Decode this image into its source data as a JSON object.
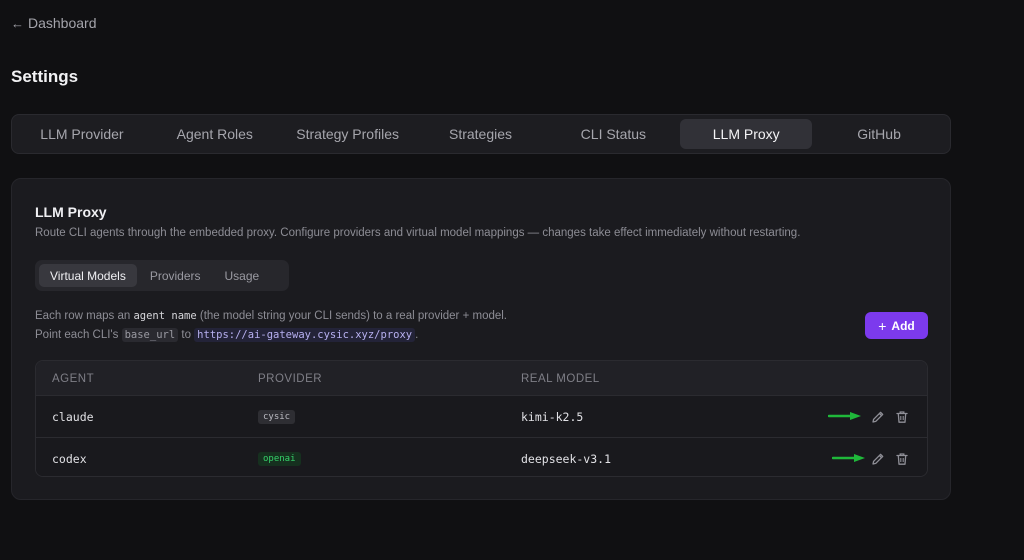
{
  "nav": {
    "back_label": "Dashboard"
  },
  "page": {
    "title": "Settings"
  },
  "tabs": [
    {
      "label": "LLM Provider",
      "active": false
    },
    {
      "label": "Agent Roles",
      "active": false
    },
    {
      "label": "Strategy Profiles",
      "active": false
    },
    {
      "label": "Strategies",
      "active": false
    },
    {
      "label": "CLI Status",
      "active": false
    },
    {
      "label": "LLM Proxy",
      "active": true
    },
    {
      "label": "GitHub",
      "active": false
    }
  ],
  "section": {
    "title": "LLM Proxy",
    "description": "Route CLI agents through the embedded proxy. Configure providers and virtual model mappings — changes take effect immediately without restarting."
  },
  "subtabs": [
    {
      "label": "Virtual Models",
      "active": true
    },
    {
      "label": "Providers",
      "active": false
    },
    {
      "label": "Usage",
      "active": false
    }
  ],
  "help": {
    "part1": "Each row maps an",
    "code_agent_name": "agent name",
    "part2": "(the model string your CLI sends) to a real provider + model. Point each CLI's",
    "code_base_url": "base_url",
    "part3": "to",
    "code_url": "https://ai-gateway.cysic.xyz/proxy",
    "part4": "."
  },
  "add_button": {
    "label": "Add"
  },
  "table": {
    "headers": {
      "agent": "AGENT",
      "provider": "PROVIDER",
      "real_model": "REAL MODEL"
    },
    "rows": [
      {
        "agent": "claude",
        "provider": "cysic",
        "real_model": "kimi-k2.5"
      },
      {
        "agent": "codex",
        "provider": "openai",
        "real_model": "deepseek-v3.1"
      }
    ]
  },
  "icons": {
    "back": "arrow-left-icon",
    "add": "plus-icon",
    "edit": "pencil-icon",
    "delete": "trash-icon",
    "annotation": "green-arrow-icon"
  },
  "colors": {
    "accent": "#7c3aed",
    "openai_badge": "#36d06a",
    "annotation_arrow": "#1fb83a"
  }
}
